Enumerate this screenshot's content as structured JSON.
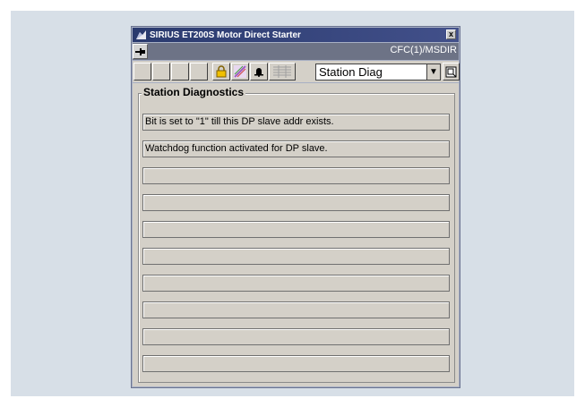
{
  "window": {
    "title": "SIRIUS ET200S Motor Direct Starter",
    "close_label": "x",
    "instance_name": "CFC(1)/MSDIR"
  },
  "toolbar": {
    "icons": [
      "lock-icon",
      "sensor-icon",
      "bell-icon",
      "grid-icon"
    ],
    "view_select": {
      "selected": "Station Diag"
    }
  },
  "group": {
    "title": "Station Diagnostics"
  },
  "diagnostics": [
    "Bit is set to \"1\" till this DP slave addr exists.",
    "Watchdog function activated for DP slave.",
    "",
    "",
    "",
    "",
    "",
    "",
    "",
    ""
  ],
  "colors": {
    "titlebar": "#2a3a6e",
    "instance_bar": "#6d7386",
    "panel": "#d4d0c8",
    "backdrop": "#d7dfe7"
  }
}
